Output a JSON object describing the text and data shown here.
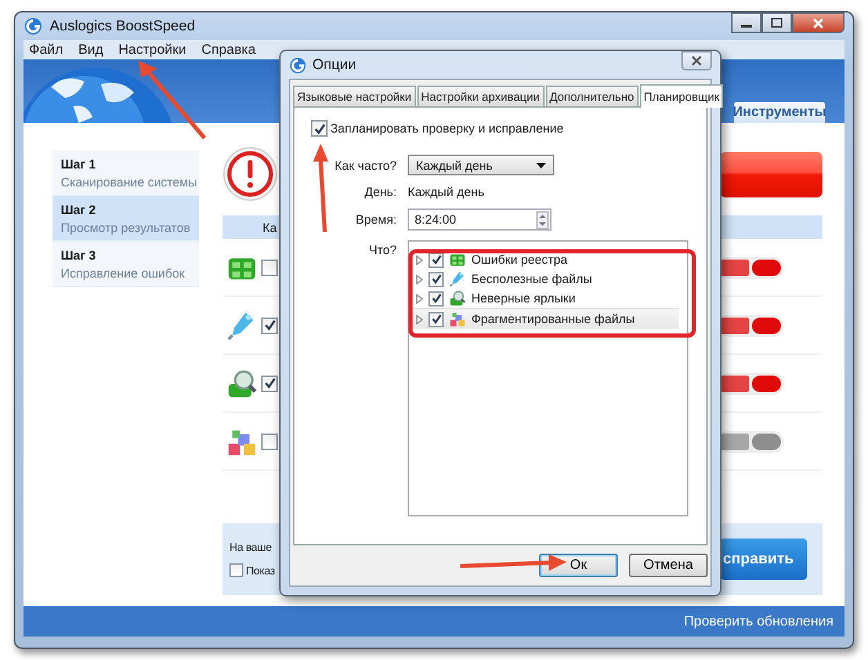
{
  "window": {
    "title": "Auslogics BoostSpeed"
  },
  "menu": [
    "Файл",
    "Вид",
    "Настройки",
    "Справка"
  ],
  "header_tabs": [
    {
      "label": "Инструменты",
      "selected": false
    }
  ],
  "steps": [
    {
      "title": "Шаг 1",
      "subtitle": "Сканирование системы",
      "selected": false
    },
    {
      "title": "Шаг 2",
      "subtitle": "Просмотр результатов",
      "selected": true
    },
    {
      "title": "Шаг 3",
      "subtitle": "Исправление ошибок",
      "selected": false
    }
  ],
  "results": {
    "header_text": "Ка",
    "rows": [
      {
        "kind": "registry",
        "checked": false,
        "color": "#e00a0a"
      },
      {
        "kind": "junk",
        "checked": true,
        "color": "#e00a0a"
      },
      {
        "kind": "shortcuts",
        "checked": true,
        "color": "#e00a0a"
      },
      {
        "kind": "fragmentation",
        "checked": false,
        "color": "#8e8e8e"
      }
    ]
  },
  "bottom_panel": {
    "text": "На ваше",
    "checkbox": {
      "label": "Показ",
      "checked": false
    },
    "button": "справить"
  },
  "status_bar": {
    "link": "Проверить обновления"
  },
  "dialog": {
    "title": "Опции",
    "tabs": [
      {
        "label": "Языковые настройки",
        "selected": false
      },
      {
        "label": "Настройки архивации",
        "selected": false
      },
      {
        "label": "Дополнительно",
        "selected": false
      },
      {
        "label": "Планировщик",
        "selected": true
      }
    ],
    "schedule": {
      "label": "Запланировать проверку и исправление",
      "checked": true
    },
    "fields": [
      {
        "kind": "dropdown",
        "label": "Как часто?",
        "value": "Каждый день"
      },
      {
        "kind": "text",
        "label": "День:",
        "value": "Каждый день"
      },
      {
        "kind": "spin",
        "label": "Время:",
        "value": "8:24:00"
      }
    ],
    "what_label": "Что?",
    "items": [
      {
        "kind": "registry",
        "label": "Ошибки реестра",
        "checked": true,
        "selected": false
      },
      {
        "kind": "junk",
        "label": "Бесполезные файлы",
        "checked": true,
        "selected": false
      },
      {
        "kind": "shortcuts",
        "label": "Неверные ярлыки",
        "checked": true,
        "selected": false
      },
      {
        "kind": "fragmentation",
        "label": "Фрагментированные файлы",
        "checked": true,
        "selected": true
      }
    ],
    "buttons": [
      {
        "label": "Ок",
        "kind": "default"
      },
      {
        "label": "Отмена",
        "kind": "normal"
      }
    ]
  }
}
